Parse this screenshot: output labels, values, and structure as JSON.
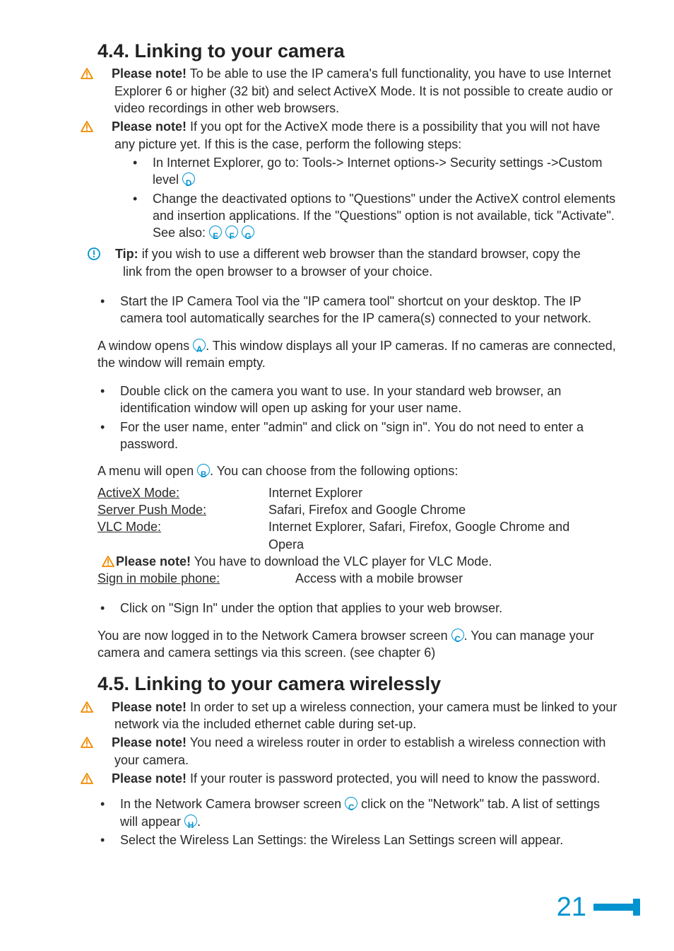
{
  "section44": {
    "heading": "4.4.  Linking to your camera",
    "note1_label": "Please note!",
    "note1_text": " To be able to use the IP camera's full functionality, you have to use Internet Explorer 6 or higher (32 bit) and select ActiveX Mode. It is not possible to create audio or video recordings in other web browsers.",
    "note2_label": "Please note!",
    "note2_text": " If you opt for the ActiveX mode there is a possibility that you will not have any picture yet. If this is the case, perform the following steps:",
    "sub_b1_a": "In Internet Explorer, go to: Tools-> Internet options-> Security settings ->Custom level ",
    "sub_b2_a": "Change the deactivated options to \"Questions\" under the ActiveX control elements and insertion applications. If the \"Questions\" option is not available, tick \"Activate\". See also: ",
    "tip_label": "Tip:",
    "tip_text1": " if you wish to use a different web browser than the standard browser, copy the",
    "tip_text2": "link from the open browser to a browser of your choice.",
    "start_bullet": "Start the IP Camera Tool via the \"IP camera tool\" shortcut on your desktop. The IP camera tool automatically searches for the IP camera(s) connected to your network.",
    "window_a": "A window opens ",
    "window_b": ". This window displays all your IP cameras. If no cameras are connected, the window will remain empty.",
    "dbl_bullet": "Double click on the camera you want to use. In your standard web browser, an identification window will open up asking for your user name.",
    "user_bullet": "For the user name, enter \"admin\" and click on \"sign in\". You do not need to enter a password.",
    "menu_a": "A menu will open ",
    "menu_b": ". You can choose from the following options:",
    "modes": {
      "activex_l": "ActiveX Mode:",
      "activex_r": "Internet Explorer",
      "serverpush_l": "Server Push Mode:",
      "serverpush_r": "Safari, Firefox and Google Chrome",
      "vlc_l": "VLC Mode:",
      "vlc_r1": "Internet Explorer, Safari, Firefox, Google Chrome and",
      "vlc_r2": "Opera"
    },
    "vlc_note_label": "Please note!",
    "vlc_note_text": " You have to download the VLC player for VLC Mode.",
    "mobile_l": "Sign in mobile phone:",
    "mobile_r": "Access with a mobile browser",
    "click_bullet": "Click on \"Sign In\" under the option that applies to your web browser.",
    "logged_a": "You are now logged in to the Network Camera browser screen ",
    "logged_b": ". You can manage your camera and camera settings via this screen. (see chapter 6)"
  },
  "section45": {
    "heading": "4.5.  Linking to your camera wirelessly",
    "note1_label": "Please note!",
    "note1_text": " In order to set up a wireless connection, your camera must be linked to your network via the included ethernet cable during set-up.",
    "note2_label": "Please note!",
    "note2_text": " You need a wireless router in order to establish a wireless connection with your camera.",
    "note3_label": "Please note!",
    "note3_text": " If your router is password protected, you will need to know the password.",
    "b1_a": "In the Network Camera browser screen ",
    "b1_b": " click on the \"Network\" tab. A list of settings will appear ",
    "b1_c": ".",
    "b2": "Select the Wireless Lan Settings: the Wireless Lan Settings screen will appear."
  },
  "letters": {
    "A": "A",
    "B": "B",
    "C": "C",
    "D": "D",
    "E": "E",
    "F": "F",
    "G": "G",
    "H": "H"
  },
  "page_number": "21"
}
